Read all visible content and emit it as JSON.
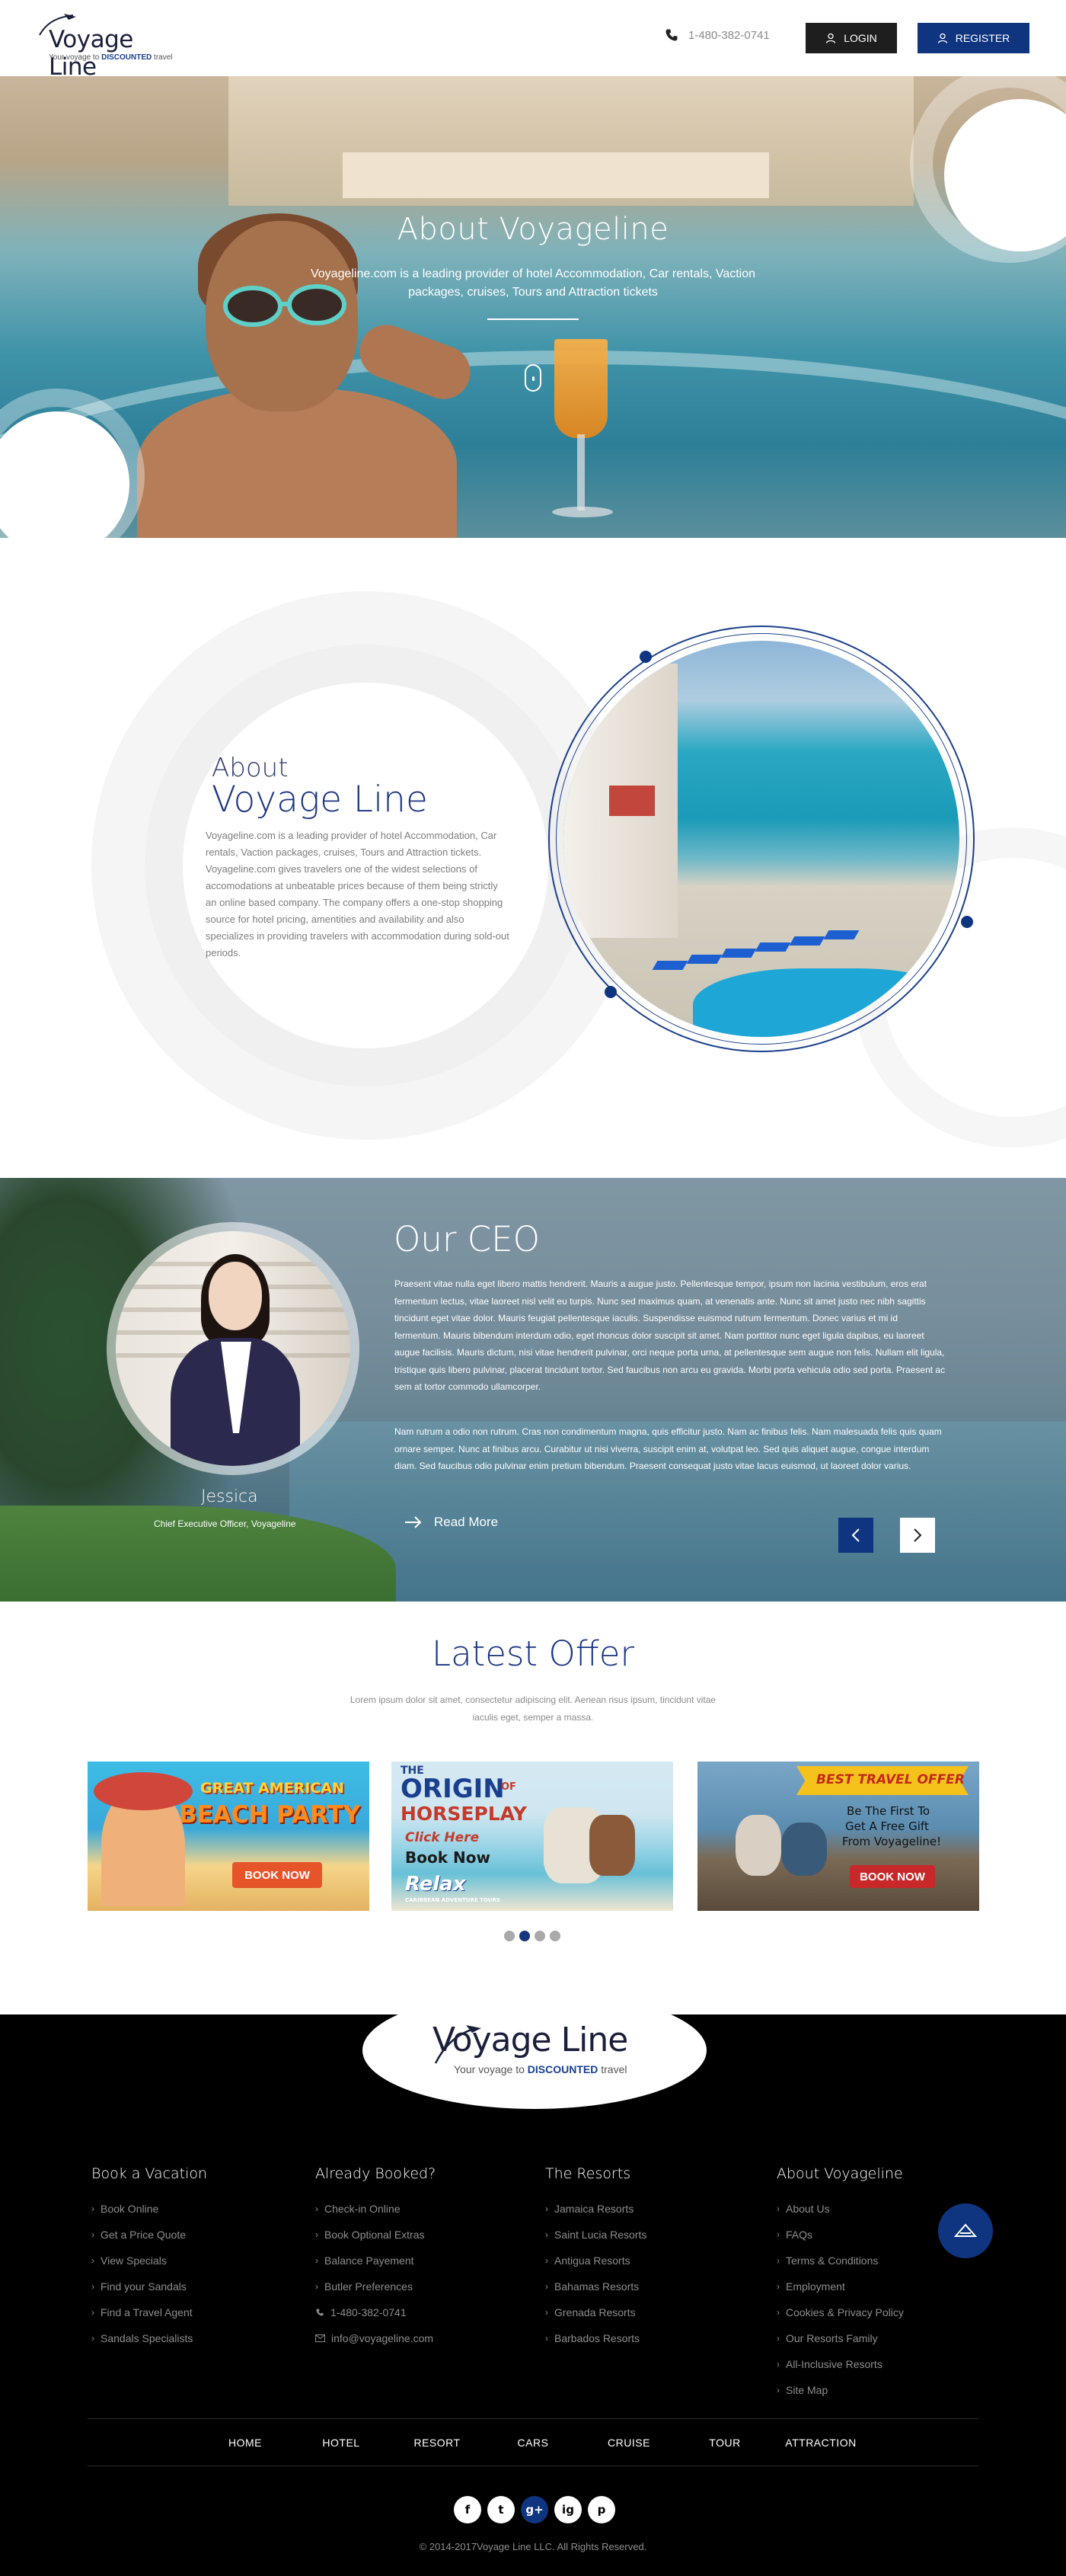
{
  "header": {
    "logo_title": "Voyage Line",
    "logo_tag_pre": "Your voyage to ",
    "logo_tag_bold": "DISCOUNTED",
    "logo_tag_post": " travel",
    "phone": "1-480-382-0741",
    "login_label": "LOGIN",
    "register_label": "REGISTER"
  },
  "hero": {
    "title": "About Voyageline",
    "description": "Voyageline.com is a leading provider of hotel Accommodation, Car rentals, Vaction packages, cruises, Tours and Attraction tickets"
  },
  "about": {
    "heading_small": "About",
    "heading_big": "Voyage Line",
    "description": "Voyageline.com is a leading provider of hotel Accommodation, Car rentals, Vaction packages, cruises, Tours and Attraction tickets. Voyageline.com gives travelers one of the widest selections of accomodations at unbeatable prices because of them being strictly an online based company. The company offers a one-stop shopping source for hotel pricing, amentities and availability and also specializes in providing travelers with accommodation during sold-out periods."
  },
  "ceo": {
    "title": "Our CEO",
    "name": "Jessica",
    "role": "Chief Executive Officer, Voyageline",
    "paragraph1": "Praesent vitae nulla eget libero mattis hendrerit. Mauris a augue justo. Pellentesque tempor, ipsum non lacinia vestibulum, eros erat fermentum lectus, vitae laoreet nisl velit eu turpis. Nunc sed maximus quam, at venenatis ante. Nunc sit amet justo nec nibh sagittis tincidunt eget vitae dolor. Mauris feugiat pellentesque iaculis. Suspendisse euismod rutrum fermentum. Donec varius et mi id fermentum. Mauris bibendum interdum odio, eget rhoncus dolor suscipit sit amet. Nam porttitor nunc eget ligula dapibus, eu laoreet augue facilisis. Mauris dictum, nisi vitae hendrerit pulvinar, orci neque porta urna, at pellentesque sem augue non felis. Nullam elit ligula, tristique quis libero pulvinar, placerat tincidunt tortor. Sed faucibus non arcu eu gravida. Morbi porta vehicula odio sed porta. Praesent ac sem at tortor commodo ullamcorper.",
    "paragraph2": "Nam rutrum a odio non rutrum. Cras non condimentum magna, quis efficitur justo. Nam ac finibus felis. Nam malesuada felis quis quam ornare semper. Nunc at finibus arcu. Curabitur ut nisi viverra, suscipit enim at, volutpat leo. Sed quis aliquet augue, congue interdum diam. Sed faucibus odio pulvinar enim pretium bibendum. Praesent consequat justo vitae lacus euismod, ut laoreet dolor varius.",
    "read_more": "Read More"
  },
  "offer": {
    "title": "Latest Offer",
    "description": "Lorem ipsum dolor sit amet, consectetur adipiscing elit. Aenean risus ipsum, tincidunt vitae iaculis eget, semper a massa.",
    "cards": [
      {
        "line1": "GREAT AMERICAN",
        "line2": "BEACH PARTY",
        "button": "BOOK NOW"
      },
      {
        "line1": "THE",
        "line2": "ORIGIN",
        "line3": "OF",
        "line4": "HORSEPLAY",
        "line5": "Click Here",
        "line6": "Book Now",
        "brand": "Relax",
        "brand_sub": "CARIBBEAN ADVENTURE TOURS"
      },
      {
        "line1": "BEST TRAVEL OFFER",
        "line2": "Be The First To",
        "line3": "Get A Free Gift",
        "line4": "From Voyageline!",
        "button": "BOOK NOW"
      }
    ]
  },
  "footer": {
    "logo_title": "Voyage Line",
    "logo_tag_pre": "Your voyage to ",
    "logo_tag_bold": "DISCOUNTED",
    "logo_tag_post": " travel",
    "columns": [
      {
        "title": "Book a Vacation",
        "items": [
          "Book Online",
          "Get a Price Quote",
          "View Specials",
          "Find your Sandals",
          "Find a Travel Agent",
          "Sandals Specialists"
        ]
      },
      {
        "title": "Already Booked?",
        "items": [
          "Check-in Online",
          "Book Optional Extras",
          "Balance Payement",
          "Butler Preferences"
        ],
        "phone": "1-480-382-0741",
        "email": "info@voyageline.com"
      },
      {
        "title": "The Resorts",
        "items": [
          "Jamaica Resorts",
          "Saint Lucia Resorts",
          "Antigua Resorts",
          "Bahamas Resorts",
          "Grenada Resorts",
          "Barbados Resorts"
        ]
      },
      {
        "title": "About Voyageline",
        "items": [
          "About Us",
          "FAQs",
          "Terms & Conditions",
          "Employment",
          "Cookies & Privacy Policy",
          "Our Resorts Family",
          "All-Inclusive Resorts",
          "Site Map"
        ]
      }
    ],
    "nav": [
      "HOME",
      "HOTEL",
      "RESORT",
      "CARS",
      "CRUISE",
      "TOUR",
      "ATTRACTION"
    ],
    "social": [
      "f",
      "t",
      "g+",
      "ig",
      "p"
    ],
    "copyright": "© 2014-2017Voyage Line LLC. All Rights Reserved."
  },
  "colors": {
    "brand_blue": "#0f3580",
    "dark": "#1e1e1e",
    "footer_bg": "#000000",
    "muted_text": "#8d8d8d"
  },
  "icons": [
    "phone-icon",
    "user-icon",
    "plane-icon",
    "mouse-scroll-icon",
    "arrow-right-icon",
    "chevron-left-icon",
    "chevron-right-icon",
    "chevron-small-icon",
    "envelope-icon",
    "back-to-top-icon",
    "facebook-icon",
    "twitter-icon",
    "google-plus-icon",
    "instagram-icon",
    "pinterest-icon"
  ]
}
